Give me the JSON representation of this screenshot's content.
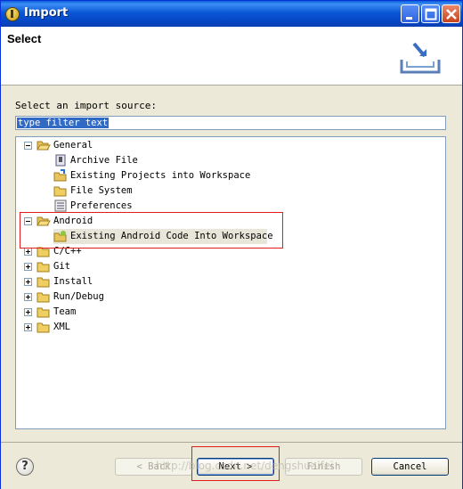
{
  "window": {
    "title": "Import",
    "minimize_icon": "minimize-icon",
    "maximize_icon": "maximize-icon",
    "close_icon": "close-icon"
  },
  "header": {
    "title": "Select",
    "image_icon": "import-tray-icon"
  },
  "prompt": "Select an import source:",
  "filter": {
    "value": "type filter text"
  },
  "tree": {
    "general": {
      "label": "General",
      "children": [
        "Archive File",
        "Existing Projects into Workspace",
        "File System",
        "Preferences"
      ]
    },
    "android": {
      "label": "Android",
      "children": [
        "Existing Android Code Into Workspace"
      ]
    },
    "collapsed": [
      "C/C++",
      "Git",
      "Install",
      "Run/Debug",
      "Team",
      "XML"
    ]
  },
  "footer": {
    "back_label": "< Back",
    "next_label": "Next >",
    "finish_label": "Finish",
    "cancel_label": "Cancel",
    "help_label": "?"
  },
  "watermark": "http://blog.csdn.net/dengshuaifei"
}
